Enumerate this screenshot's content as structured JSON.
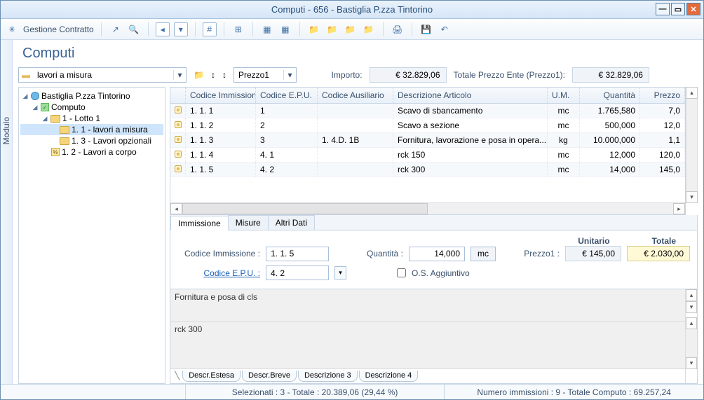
{
  "window": {
    "title": "Computi - 656 - Bastiglia P.zza Tintorino"
  },
  "toolbar": {
    "contract_label": "Gestione Contratto"
  },
  "page": {
    "title": "Computi"
  },
  "filter": {
    "type": {
      "label": "lavori a misura"
    },
    "price": {
      "label": "Prezzo1"
    },
    "importo_label": "Importo:",
    "importo_value": "€ 32.829,06",
    "totale_label": "Totale Prezzo Ente (Prezzo1):",
    "totale_value": "€ 32.829,06"
  },
  "side_tab": "Modulo",
  "tree": {
    "root": "Bastiglia P.zza Tintorino",
    "computo": "Computo",
    "lotto": "1 - Lotto 1",
    "items": [
      "1. 1 - lavori a misura",
      "1. 3 - Lavori opzionali",
      "1. 2 - Lavori a corpo"
    ]
  },
  "grid": {
    "headers": {
      "codimm": "Codice Immissione",
      "codepu": "Codice E.P.U.",
      "codaux": "Codice Ausiliario",
      "descr": "Descrizione Articolo",
      "um": "U.M.",
      "qta": "Quantità",
      "prezzo": "Prezzo"
    },
    "rows": [
      {
        "codimm": "1. 1. 1",
        "codepu": "1",
        "codaux": "",
        "descr": "Scavo di sbancamento",
        "um": "mc",
        "qta": "1.765,580",
        "prezzo": "7,0"
      },
      {
        "codimm": "1. 1. 2",
        "codepu": "2",
        "codaux": "",
        "descr": "Scavo a sezione",
        "um": "mc",
        "qta": "500,000",
        "prezzo": "12,0"
      },
      {
        "codimm": "1. 1. 3",
        "codepu": "3",
        "codaux": "1. 4.D. 1B",
        "descr": "Fornitura, lavorazione e posa in opera...",
        "um": "kg",
        "qta": "10.000,000",
        "prezzo": "1,1"
      },
      {
        "codimm": "1. 1. 4",
        "codepu": "4. 1",
        "codaux": "",
        "descr": "rck 150",
        "um": "mc",
        "qta": "12,000",
        "prezzo": "120,0"
      },
      {
        "codimm": "1. 1. 5",
        "codepu": "4. 2",
        "codaux": "",
        "descr": "rck 300",
        "um": "mc",
        "qta": "14,000",
        "prezzo": "145,0"
      }
    ]
  },
  "detail": {
    "tabs": [
      "Immissione",
      "Misure",
      "Altri Dati"
    ],
    "header": {
      "unitario": "Unitario",
      "totale": "Totale"
    },
    "codimm_label": "Codice Immissione :",
    "codimm_value": "1. 1. 5",
    "qta_label": "Quantità :",
    "qta_value": "14,000",
    "qta_um": "mc",
    "prezzo_label": "Prezzo1 :",
    "prezzo_unit": "€ 145,00",
    "prezzo_tot": "€ 2.030,00",
    "codepu_label": "Codice E.P.U. :",
    "codepu_value": "4. 2",
    "os_label": "O.S. Aggiuntivo",
    "desc1": "Fornitura e posa di cls",
    "desc2": "rck 300",
    "bottom_tabs": [
      "Descr.Estesa",
      "Descr.Breve",
      "Descrizione 3",
      "Descrizione 4"
    ]
  },
  "status": {
    "sel": "Selezionati : 3 - Totale : 20.389,06 (29,44 %)",
    "num": "Numero immissioni : 9 - Totale Computo : 69.257,24"
  }
}
